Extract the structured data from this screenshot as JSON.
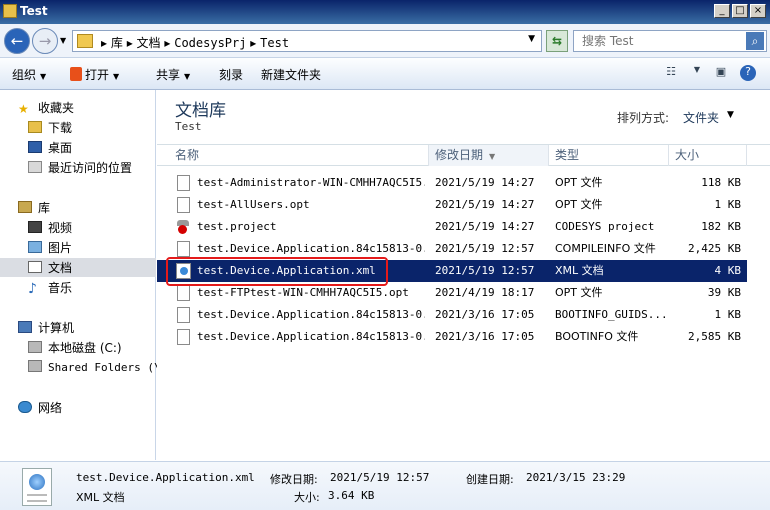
{
  "window": {
    "title": "Test"
  },
  "address": {
    "crumbs": [
      "库",
      "文档",
      "CodesysPrj",
      "Test"
    ],
    "search_placeholder": "搜索 Test"
  },
  "toolbar": {
    "organize": "组织",
    "open": "打开",
    "share": "共享",
    "burn": "刻录",
    "new_folder": "新建文件夹"
  },
  "nav": {
    "favorites": "收藏夹",
    "downloads": "下载",
    "desktop": "桌面",
    "recent": "最近访问的位置",
    "libraries": "库",
    "videos": "视频",
    "pictures": "图片",
    "documents": "文档",
    "music": "音乐",
    "computer": "计算机",
    "local_disk": "本地磁盘 (C:)",
    "shared_folders": "Shared Folders (\\\\",
    "network": "网络"
  },
  "library": {
    "title": "文档库",
    "subtitle": "Test",
    "sort_label": "排列方式:",
    "sort_value": "文件夹"
  },
  "columns": {
    "name": "名称",
    "date": "修改日期",
    "type": "类型",
    "size": "大小"
  },
  "files": [
    {
      "name": "test-Administrator-WIN-CMHH7AQC5I5...",
      "date": "2021/5/19 14:27",
      "type": "OPT 文件",
      "size": "118 KB"
    },
    {
      "name": "test-AllUsers.opt",
      "date": "2021/5/19 14:27",
      "type": "OPT 文件",
      "size": "1 KB"
    },
    {
      "name": "test.project",
      "date": "2021/5/19 14:27",
      "type": "CODESYS project",
      "size": "182 KB"
    },
    {
      "name": "test.Device.Application.84c15813-0...",
      "date": "2021/5/19 12:57",
      "type": "COMPILEINFO 文件",
      "size": "2,425 KB"
    },
    {
      "name": "test.Device.Application.xml",
      "date": "2021/5/19 12:57",
      "type": "XML 文档",
      "size": "4 KB"
    },
    {
      "name": "test-FTPtest-WIN-CMHH7AQC5I5.opt",
      "date": "2021/4/19 18:17",
      "type": "OPT 文件",
      "size": "39 KB"
    },
    {
      "name": "test.Device.Application.84c15813-0...",
      "date": "2021/3/16 17:05",
      "type": "BOOTINFO_GUIDS...",
      "size": "1 KB"
    },
    {
      "name": "test.Device.Application.84c15813-0...",
      "date": "2021/3/16 17:05",
      "type": "BOOTINFO 文件",
      "size": "2,585 KB"
    }
  ],
  "details": {
    "filename": "test.Device.Application.xml",
    "modified_label": "修改日期:",
    "modified_value": "2021/5/19 12:57",
    "created_label": "创建日期:",
    "created_value": "2021/3/15 23:29",
    "type": "XML 文档",
    "size_label": "大小:",
    "size_value": "3.64 KB"
  },
  "colors": {
    "selection": "#0a246a",
    "highlight_box": "#e41a1a",
    "title_bar": "#0a246a"
  }
}
